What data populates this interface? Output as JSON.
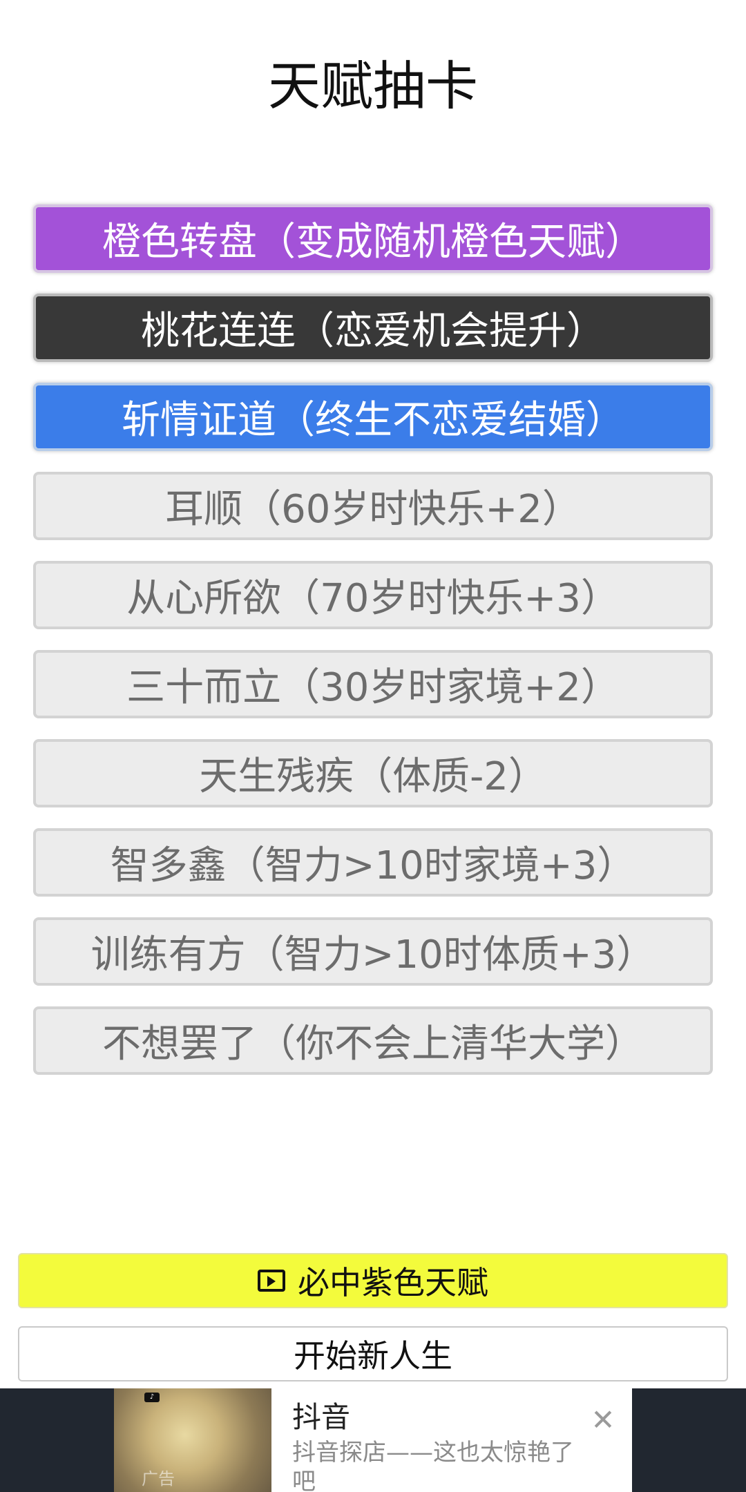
{
  "page": {
    "title": "天赋抽卡"
  },
  "talents": [
    {
      "label": "橙色转盘（变成随机橙色天赋）",
      "state": "selected",
      "color": "#a352d8"
    },
    {
      "label": "桃花连连（恋爱机会提升）",
      "state": "selected",
      "color": "#383838"
    },
    {
      "label": "斩情证道（终生不恋爱结婚）",
      "state": "selected",
      "color": "#3b7de9"
    },
    {
      "label": "耳顺（60岁时快乐+2）",
      "state": "normal"
    },
    {
      "label": "从心所欲（70岁时快乐+3）",
      "state": "normal"
    },
    {
      "label": "三十而立（30岁时家境+2）",
      "state": "normal"
    },
    {
      "label": "天生残疾（体质-2）",
      "state": "normal"
    },
    {
      "label": "智多鑫（智力>10时家境+3）",
      "state": "normal"
    },
    {
      "label": "训练有方（智力>10时体质+3）",
      "state": "normal"
    },
    {
      "label": "不想罢了（你不会上清华大学）",
      "state": "normal"
    }
  ],
  "actions": {
    "guaranteed_purple": {
      "label": "必中紫色天赋",
      "icon": "video-icon",
      "color": "#f3fb3c"
    },
    "start_new_life": {
      "label": "开始新人生"
    }
  },
  "ad": {
    "title": "抖音",
    "description": "抖音探店——这也太惊艳了吧",
    "thumb_label": "广告",
    "close_icon": "close-icon"
  }
}
